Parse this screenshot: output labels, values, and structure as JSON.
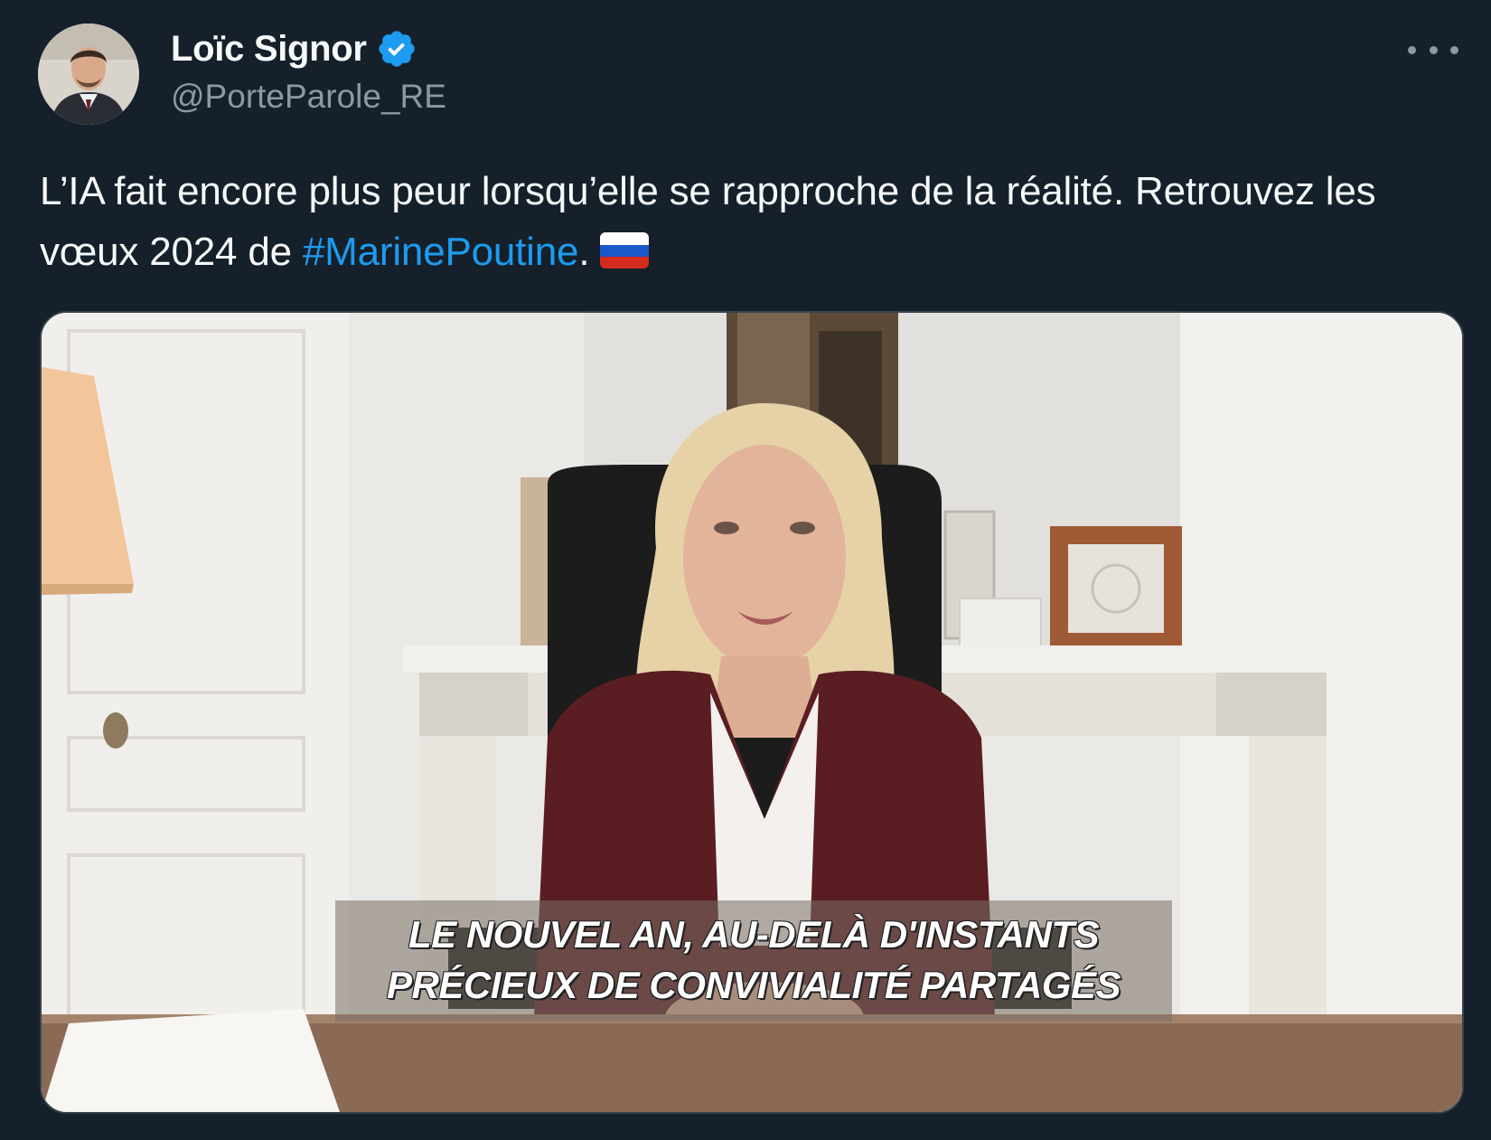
{
  "author": {
    "display_name": "Loïc Signor",
    "handle": "@PorteParole_RE",
    "verified": true
  },
  "tweet": {
    "text_before": "L’IA fait encore plus peur lorsqu’elle se rapproche de la réalité. Retrouvez les vœux 2024 de ",
    "hashtag": "#MarinePoutine",
    "text_after": ".",
    "emoji": "russia-flag-emoji"
  },
  "media": {
    "type": "video",
    "subtitle_line1": "LE NOUVEL AN, AU-DELÀ D'INSTANTS",
    "subtitle_line2": "PRÉCIEUX DE CONVIVIALITÉ PARTAGÉS"
  },
  "icons": {
    "verified": "verified-badge-icon",
    "more": "more-options-icon"
  },
  "colors": {
    "background": "#15202b",
    "text_primary": "#f7f9f9",
    "text_secondary": "#8b98a5",
    "accent": "#1d9bf0"
  }
}
